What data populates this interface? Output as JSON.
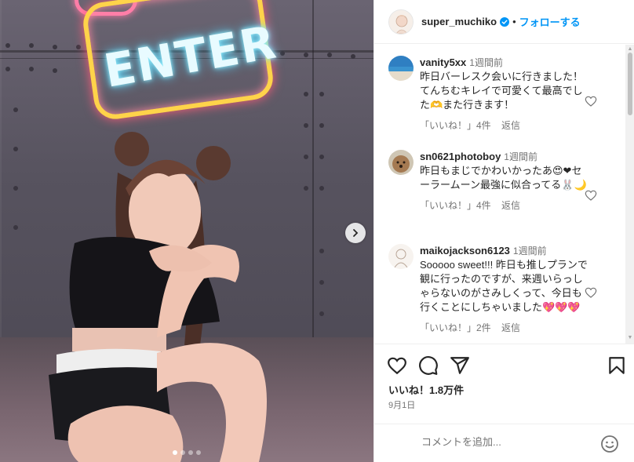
{
  "post": {
    "neon_text": "ENTER",
    "carousel": {
      "count": 4,
      "active_index": 0
    }
  },
  "header": {
    "username": "super_muchiko",
    "separator": "•",
    "follow_label": "フォローする"
  },
  "comments": [
    {
      "user": "vanity5xx",
      "time": "1週間前",
      "text": "昨日バーレスク会いに行きました！てんちむキレイで可愛くて最高でした🫶また行きます！",
      "likes": "「いいね！」4件",
      "reply": "返信"
    },
    {
      "user": "sn0621photoboy",
      "time": "1週間前",
      "text": "昨日もまじでかわいかったあ😍❤セーラームーン最強に似合ってる🐰🌙",
      "likes": "「いいね！」4件",
      "reply": "返信"
    },
    {
      "user": "maikojackson6123",
      "time": "1週間前",
      "text": "Sooooo sweet!!! 昨日も推しプランで観に行ったのですが、来週いらっしゃらないのがさみしくって、今日も行くことにしちゃいました💖💖💖",
      "likes": "「いいね！」2件",
      "reply": "返信"
    }
  ],
  "stats": {
    "likes": "いいね！1.8万件",
    "date": "9月1日"
  },
  "comment_box": {
    "placeholder": "コメントを追加..."
  },
  "colors": {
    "accent": "#0095f6",
    "text": "#262626",
    "muted": "#737373",
    "border": "#efefef"
  },
  "icons": [
    "verified-badge-icon",
    "heart-icon",
    "comment-icon",
    "share-icon",
    "bookmark-icon",
    "emoji-icon",
    "chevron-right-icon"
  ]
}
